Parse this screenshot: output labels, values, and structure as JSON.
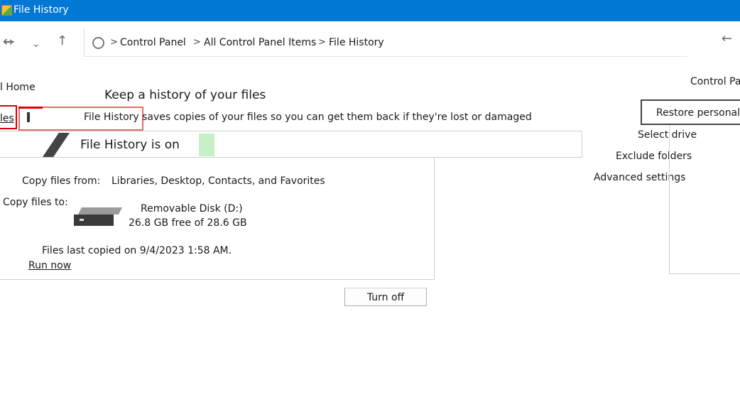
{
  "window": {
    "title": "File History"
  },
  "breadcrumb": {
    "items": [
      "Control Panel",
      "All Control Panel Items",
      "File History"
    ],
    "separator": ">"
  },
  "nav": {
    "back_icon": "arrow-left-icon",
    "forward_icon": "arrow-right-icon",
    "recent_icon": "chevron-down-icon",
    "up_icon": "arrow-up-icon",
    "refresh_icon": "refresh-icon"
  },
  "left_nav": {
    "home": "l Home",
    "les": "les"
  },
  "main": {
    "heading": "Keep a history of your files",
    "subtitle": "File History saves copies of your files so you can get them back if they're lost or damaged",
    "status": "File History is on",
    "copy_from_label": "Copy files from:",
    "copy_from_value": "Libraries, Desktop, Contacts, and Favorites",
    "copy_to_label": "Copy files to:",
    "drive_name": "Removable Disk (D:)",
    "drive_space": "26.8 GB free of 28.6 GB",
    "last_copied": "Files last copied on 9/4/2023 1:58 AM.",
    "run_now": "Run now",
    "turn_off": "Turn off"
  },
  "right_nav": {
    "control_panel": "Control Pa",
    "restore": "Restore personal f",
    "select_drive": "Select drive",
    "exclude_folders": "Exclude folders",
    "advanced_settings": "Advanced settings"
  },
  "colors": {
    "titlebar": "#0078d4",
    "highlight_red": "#d90000",
    "highlight_pink": "#e86a6a"
  }
}
